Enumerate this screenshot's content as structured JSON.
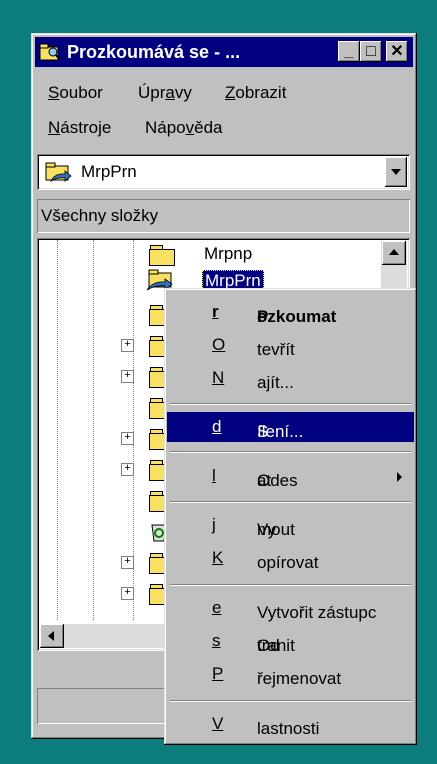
{
  "window": {
    "title": "Prozkoumává se - ..."
  },
  "titlebar_buttons": {
    "minimize": "_",
    "maximize": "□",
    "close": "✕"
  },
  "menu": {
    "soubor": [
      "S",
      "oubor"
    ],
    "upravy": [
      "Úpr",
      "a",
      "vy"
    ],
    "zobrazit": [
      "Z",
      "obrazit"
    ],
    "nastroje": [
      "N",
      "ástroje"
    ],
    "napoveda": [
      "Nápo",
      "v",
      "ěda"
    ]
  },
  "address": {
    "value": "MrpPrn"
  },
  "panel": {
    "header": "Všechny složky"
  },
  "tree": {
    "items": [
      {
        "label": "Mrpnp"
      },
      {
        "label": "MrpPrn"
      }
    ]
  },
  "context_menu": {
    "prozkoumat": [
      "P",
      "r",
      "ozkoumat"
    ],
    "otevrit": [
      "",
      "O",
      "tevřít"
    ],
    "najit": [
      "",
      "N",
      "ajít..."
    ],
    "sdileni": [
      "S",
      "d",
      "ílení..."
    ],
    "odeslat": [
      "Odes",
      "l",
      "at"
    ],
    "vyjmout": [
      "Vy",
      "j",
      "mout"
    ],
    "kopirovat": [
      "",
      "K",
      "opírovat"
    ],
    "vytvorit_zastupce": [
      "Vytvořit zástupc",
      "e",
      ""
    ],
    "odstranit": [
      "Od",
      "s",
      "tranit"
    ],
    "prejmenovat": [
      "",
      "P",
      "řejmenovat"
    ],
    "vlastnosti": [
      "",
      "V",
      "lastnosti"
    ]
  },
  "colors": {
    "desktop": "#0c7d7c",
    "titlebar": "#000080",
    "highlight": "#000080",
    "face": "#c0c0c0"
  }
}
